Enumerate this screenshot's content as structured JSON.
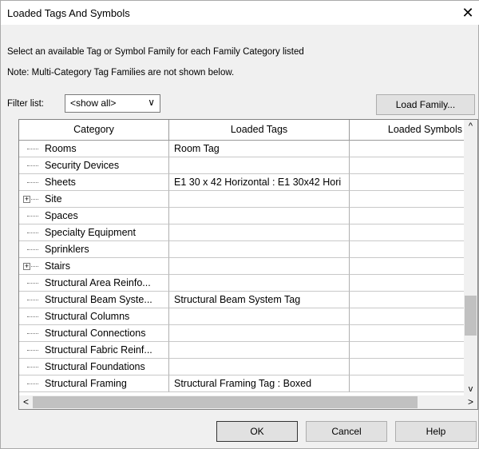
{
  "window": {
    "title": "Loaded Tags And Symbols",
    "close_label": "✕"
  },
  "instructions": {
    "line1": "Select an available Tag or Symbol Family for each Family Category listed",
    "line2": "Note: Multi-Category Tag Families are not shown below."
  },
  "filter": {
    "label": "Filter list:",
    "value": "<show all>"
  },
  "buttons": {
    "load_family": "Load Family...",
    "ok": "OK",
    "cancel": "Cancel",
    "help": "Help"
  },
  "table": {
    "columns": [
      "Category",
      "Loaded Tags",
      "Loaded Symbols"
    ],
    "rows": [
      {
        "category": "Rooms",
        "tags": "Room Tag",
        "symbols": "",
        "expander": ""
      },
      {
        "category": "Security Devices",
        "tags": "",
        "symbols": "",
        "expander": ""
      },
      {
        "category": "Sheets",
        "tags": "E1 30 x 42 Horizontal : E1 30x42 Hori",
        "symbols": "",
        "expander": ""
      },
      {
        "category": "Site",
        "tags": "",
        "symbols": "",
        "expander": "+"
      },
      {
        "category": "Spaces",
        "tags": "",
        "symbols": "",
        "expander": ""
      },
      {
        "category": "Specialty Equipment",
        "tags": "",
        "symbols": "",
        "expander": ""
      },
      {
        "category": "Sprinklers",
        "tags": "",
        "symbols": "",
        "expander": ""
      },
      {
        "category": "Stairs",
        "tags": "",
        "symbols": "",
        "expander": "+"
      },
      {
        "category": "Structural Area Reinfo...",
        "tags": "",
        "symbols": "",
        "expander": ""
      },
      {
        "category": "Structural Beam Syste...",
        "tags": "Structural Beam System Tag",
        "symbols": "",
        "expander": ""
      },
      {
        "category": "Structural Columns",
        "tags": "",
        "symbols": "",
        "expander": ""
      },
      {
        "category": "Structural Connections",
        "tags": "",
        "symbols": "",
        "expander": ""
      },
      {
        "category": "Structural Fabric Reinf...",
        "tags": "",
        "symbols": "",
        "expander": ""
      },
      {
        "category": "Structural Foundations",
        "tags": "",
        "symbols": "",
        "expander": ""
      },
      {
        "category": "Structural Framing",
        "tags": "Structural Framing Tag : Boxed",
        "symbols": "",
        "expander": ""
      }
    ]
  },
  "scrollbar": {
    "up": "^",
    "down": "v",
    "left": "<",
    "right": ">"
  }
}
